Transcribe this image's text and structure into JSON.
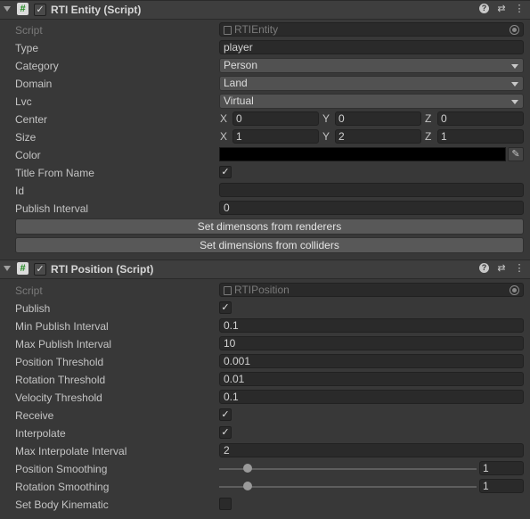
{
  "entity": {
    "header": {
      "title": "RTI Entity (Script)",
      "help_icon": "?",
      "preset_icon": "⇄",
      "menu_icon": "⋮"
    },
    "script": {
      "label": "Script",
      "value": "RTIEntity"
    },
    "type": {
      "label": "Type",
      "value": "player"
    },
    "category": {
      "label": "Category",
      "value": "Person"
    },
    "domain": {
      "label": "Domain",
      "value": "Land"
    },
    "lvc": {
      "label": "Lvc",
      "value": "Virtual"
    },
    "center": {
      "label": "Center",
      "x_label": "X",
      "x": "0",
      "y_label": "Y",
      "y": "0",
      "z_label": "Z",
      "z": "0"
    },
    "size": {
      "label": "Size",
      "x_label": "X",
      "x": "1",
      "y_label": "Y",
      "y": "2",
      "z_label": "Z",
      "z": "1"
    },
    "color": {
      "label": "Color",
      "value": "#000000"
    },
    "title_from_name": {
      "label": "Title From Name",
      "checked": true
    },
    "id": {
      "label": "Id",
      "value": ""
    },
    "publish_interval": {
      "label": "Publish Interval",
      "value": "0"
    },
    "btn_renderers": "Set dimensons from renderers",
    "btn_colliders": "Set dimensions from colliders"
  },
  "position": {
    "header": {
      "title": "RTI Position (Script)",
      "help_icon": "?",
      "preset_icon": "⇄",
      "menu_icon": "⋮"
    },
    "script": {
      "label": "Script",
      "value": "RTIPosition"
    },
    "publish": {
      "label": "Publish",
      "checked": true
    },
    "min_publish_interval": {
      "label": "Min Publish Interval",
      "value": "0.1"
    },
    "max_publish_interval": {
      "label": "Max Publish Interval",
      "value": "10"
    },
    "position_threshold": {
      "label": "Position Threshold",
      "value": "0.001"
    },
    "rotation_threshold": {
      "label": "Rotation Threshold",
      "value": "0.01"
    },
    "velocity_threshold": {
      "label": "Velocity Threshold",
      "value": "0.1"
    },
    "receive": {
      "label": "Receive",
      "checked": true
    },
    "interpolate": {
      "label": "Interpolate",
      "checked": true
    },
    "max_interpolate_interval": {
      "label": "Max Interpolate Interval",
      "value": "2"
    },
    "position_smoothing": {
      "label": "Position Smoothing",
      "value": "1",
      "slider_fraction": 0.11
    },
    "rotation_smoothing": {
      "label": "Rotation Smoothing",
      "value": "1",
      "slider_fraction": 0.11
    },
    "set_body_kinematic": {
      "label": "Set Body Kinematic",
      "checked": false
    }
  },
  "icons": {
    "check": "✓",
    "script_glyph": "#",
    "eyedropper": "✎"
  }
}
